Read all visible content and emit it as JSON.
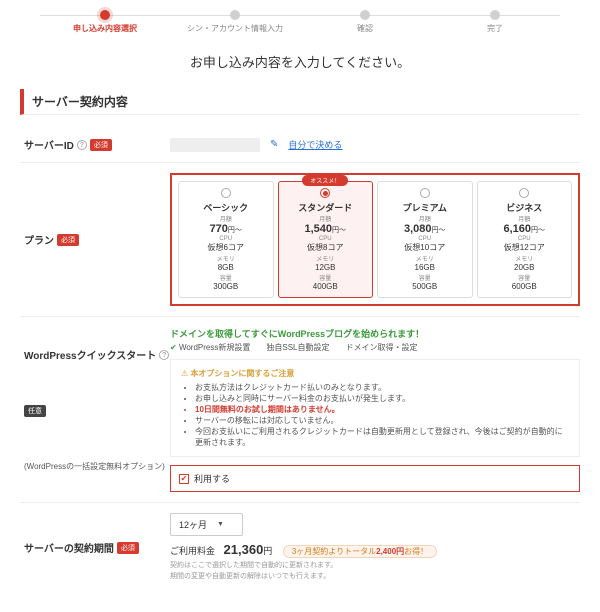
{
  "stepper": {
    "s1": "申し込み内容選択",
    "s2": "シン・アカウント情報入力",
    "s3": "確認",
    "s4": "完了"
  },
  "page_title": "お申し込み内容を入力してください。",
  "section_title": "サーバー契約内容",
  "badges": {
    "required": "必須",
    "optional": "任意"
  },
  "server_id": {
    "label": "サーバーID",
    "link": "自分で決める"
  },
  "plan": {
    "label": "プラン",
    "ribbon": "オススメ！",
    "items": [
      {
        "name": "ベーシック",
        "price": "770",
        "cpu": "仮想6コア",
        "mem": "8GB",
        "disk": "300GB"
      },
      {
        "name": "スタンダード",
        "price": "1,540",
        "cpu": "仮想8コア",
        "mem": "12GB",
        "disk": "400GB"
      },
      {
        "name": "プレミアム",
        "price": "3,080",
        "cpu": "仮想10コア",
        "mem": "16GB",
        "disk": "500GB"
      },
      {
        "name": "ビジネス",
        "price": "6,160",
        "cpu": "仮想12コア",
        "mem": "20GB",
        "disk": "600GB"
      }
    ],
    "sub_month": "月額",
    "sub_yen": "円～",
    "spec_cpu": "CPU",
    "spec_mem": "メモリ",
    "spec_disk": "容量"
  },
  "wp": {
    "label": "WordPressクイックスタート",
    "label_sub": "(WordPressの一括設定無料オプション)",
    "green_title": "ドメインを取得してすぐにWordPressブログを始められます！",
    "green_items": "WordPress新規設置　　独自SSL自動設定　　ドメイン取得・設定",
    "warn_title": "本オプションに関するご注意",
    "warn_li1": "お支払方法はクレジットカード払いのみとなります。",
    "warn_li2": "お申し込みと同時にサーバー料金のお支払いが発生します。",
    "warn_li3": "10日間無料のお試し期間はありません。",
    "warn_li4": "サーバーの移転には対応していません。",
    "warn_li5": "今回お支払いにご利用されるクレジットカードは自動更新用として登録され、今後はご契約が自動的に更新されます。",
    "use": "利用する"
  },
  "period": {
    "label": "サーバーの契約期間",
    "select_value": "12ヶ月",
    "fee_label": "ご利用料金",
    "fee_amount": "21,360",
    "fee_yen": "円",
    "save_prefix": "3ヶ月契約よりトータル",
    "save_amount": "2,400円",
    "save_suffix": "お得！",
    "note1": "契約はここで選択した期間で自動的に更新されます。",
    "note2": "期間の変更や自動更新の解除はいつでも行えます。"
  }
}
